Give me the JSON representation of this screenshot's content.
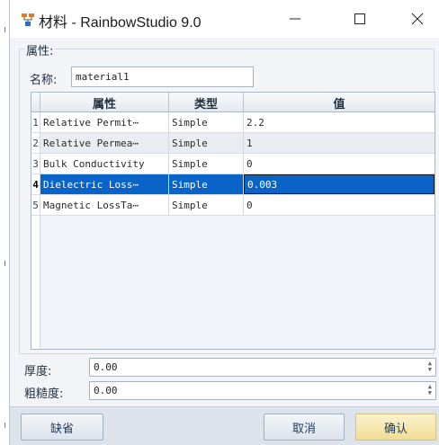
{
  "window": {
    "title": "材料 - RainbowStudio 9.0",
    "icon": "app-network-icon",
    "controls": [
      "minimize-icon",
      "maximize-icon",
      "close-icon"
    ]
  },
  "properties_group": {
    "legend": "属性:"
  },
  "name_field": {
    "label": "名称:",
    "value": "material1"
  },
  "grid": {
    "headers": [
      "属性",
      "类型",
      "值"
    ],
    "rows": [
      {
        "index": "1",
        "property": "Relative Permit⋯",
        "type": "Simple",
        "value": "2.2"
      },
      {
        "index": "2",
        "property": "Relative Permea⋯",
        "type": "Simple",
        "value": "1"
      },
      {
        "index": "3",
        "property": "Bulk Conductivity",
        "type": "Simple",
        "value": "0"
      },
      {
        "index": "4",
        "property": "Dielectric Loss⋯",
        "type": "Simple",
        "value": "0.003"
      },
      {
        "index": "5",
        "property": "Magnetic LossTa⋯",
        "type": "Simple",
        "value": "0"
      }
    ],
    "selected_row": 4,
    "selection_color": "#0a64c8"
  },
  "thickness": {
    "label": "厚度:",
    "value": "0.00"
  },
  "roughness": {
    "label": "粗糙度:",
    "value": "0.00"
  },
  "buttons": {
    "default_label": "缺省",
    "cancel_label": "取消",
    "ok_label": "确认"
  }
}
